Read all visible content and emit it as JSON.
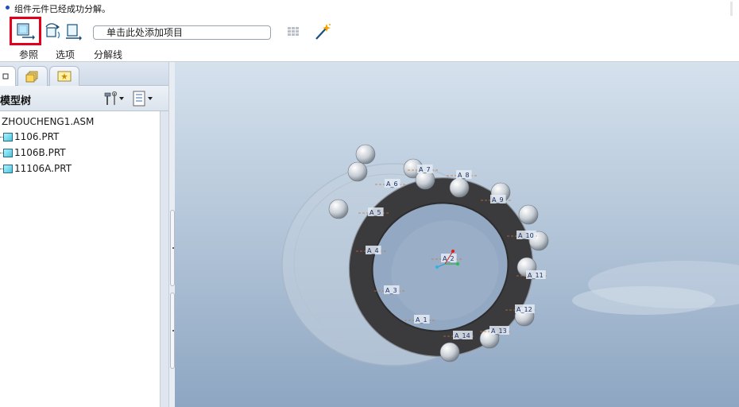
{
  "status": {
    "message": "组件元件已经成功分解。"
  },
  "dashboard": {
    "add_item_text": "单击此处添加项目",
    "tabs": [
      "参照",
      "选项",
      "分解线"
    ]
  },
  "model_tree": {
    "title": "模型树",
    "items": [
      "ZHOUCHENG1.ASM",
      "1106.PRT",
      "1106B.PRT",
      "11106A.PRT"
    ]
  },
  "datum_axes": [
    "A_1",
    "A_2",
    "A_3",
    "A_4",
    "A_5",
    "A_6",
    "A_7",
    "A_8",
    "A_9",
    "A_10",
    "A_11",
    "A_12",
    "A_13",
    "A_14"
  ],
  "icons": {
    "toolbar": [
      "move-component-icon",
      "rotate-component-icon",
      "copy-position-icon",
      "grid-icon",
      "magic-wand-icon"
    ],
    "tree_tools": [
      "settings-icon",
      "show-icon"
    ]
  },
  "colors": {
    "selected_border": "#e2001a",
    "graphics_top": "#d5e1ed",
    "graphics_bottom": "#8ea6c2"
  }
}
